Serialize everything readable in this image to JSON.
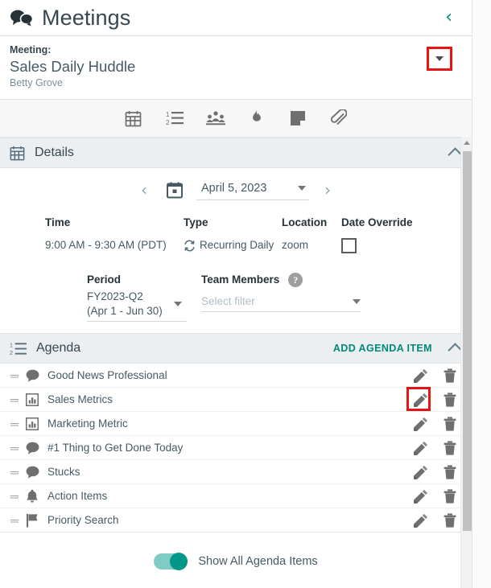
{
  "header": {
    "title": "Meetings",
    "chat_icon": "chat-bubbles-icon",
    "back_chevron": "‹"
  },
  "meeting": {
    "label": "Meeting:",
    "title": "Sales Daily Huddle",
    "owner": "Betty Grove",
    "caret_icon": "caret-down-icon"
  },
  "toolbar": {
    "icons": [
      {
        "name": "calendar-icon"
      },
      {
        "name": "numbered-list-icon"
      },
      {
        "name": "people-group-icon"
      },
      {
        "name": "flame-icon"
      },
      {
        "name": "note-icon"
      },
      {
        "name": "paperclip-icon"
      }
    ]
  },
  "details": {
    "section_title": "Details",
    "section_icon": "calendar-icon",
    "collapse_icon": "chevron-up-icon",
    "date_nav": {
      "prev": "‹",
      "next": "›",
      "calendar_icon": "calendar-today-icon",
      "value": "April 5, 2023"
    },
    "fields": {
      "time_label": "Time",
      "time_value": "9:00 AM - 9:30 AM (PDT)",
      "type_label": "Type",
      "type_value": "Recurring Daily",
      "type_icon": "recurring-icon",
      "location_label": "Location",
      "location_value": "zoom",
      "date_override_label": "Date Override",
      "date_override_checked": false
    },
    "period": {
      "label": "Period",
      "value_line1": "FY2023-Q2",
      "value_line2": "(Apr 1 - Jun 30)"
    },
    "team_members": {
      "label": "Team Members",
      "help_glyph": "?",
      "placeholder": "Select filter",
      "value": ""
    }
  },
  "agenda": {
    "section_title": "Agenda",
    "section_icon": "numbered-list-icon",
    "add_label": "ADD AGENDA ITEM",
    "collapse_icon": "chevron-up-icon",
    "items": [
      {
        "label": "Good News Professional",
        "icon": "speech-bubble-icon"
      },
      {
        "label": "Sales Metrics",
        "icon": "bar-chart-icon"
      },
      {
        "label": "Marketing Metric",
        "icon": "bar-chart-icon"
      },
      {
        "label": "#1 Thing to Get Done Today",
        "icon": "speech-bubble-icon"
      },
      {
        "label": "Stucks",
        "icon": "speech-bubble-icon"
      },
      {
        "label": "Action Items",
        "icon": "bell-icon"
      },
      {
        "label": "Priority Search",
        "icon": "flag-icon"
      }
    ],
    "edit_icon": "pencil-icon",
    "delete_icon": "trash-icon",
    "highlighted_row_index": 1,
    "toggle": {
      "label": "Show All Agenda Items",
      "on": true
    }
  },
  "colors": {
    "accent_teal": "#00897b",
    "toggle_on": "#009688",
    "highlight_red": "#e81313",
    "section_bg": "#eceff1",
    "text_primary": "#37474f",
    "text_secondary": "#455a64",
    "text_muted": "#78909c"
  },
  "scrollbar": {
    "arrow_icon": "scroll-up-arrow-icon"
  }
}
